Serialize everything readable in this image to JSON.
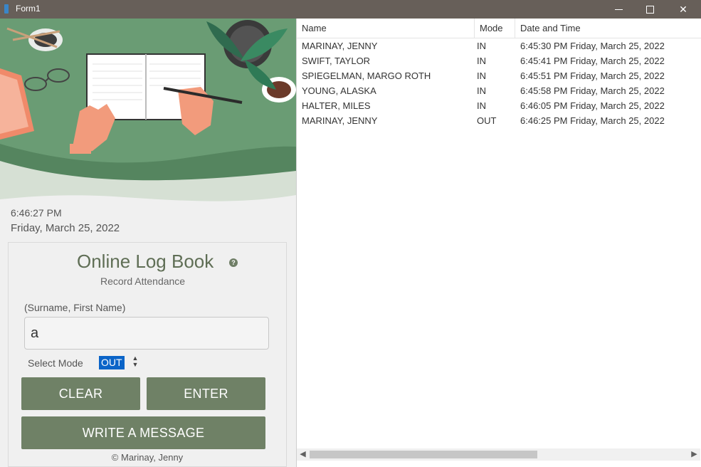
{
  "window": {
    "title": "Form1"
  },
  "clock": {
    "time": "6:46:27 PM",
    "date": "Friday, March 25, 2022"
  },
  "logbook": {
    "title": "Online Log Book",
    "subtitle": "Record Attendance",
    "name_hint": "(Surname, First Name)",
    "name_value": "a",
    "mode_label": "Select Mode",
    "mode_value": "OUT",
    "clear_label": "CLEAR",
    "enter_label": "ENTER",
    "message_label": "WRITE A MESSAGE",
    "copyright": "© Marinay, Jenny"
  },
  "list": {
    "columns": [
      "Name",
      "Mode",
      "Date and Time"
    ],
    "rows": [
      [
        "MARINAY, JENNY",
        "IN",
        "6:45:30 PM Friday, March 25, 2022"
      ],
      [
        "SWIFT, TAYLOR",
        "IN",
        "6:45:41 PM Friday, March 25, 2022"
      ],
      [
        "SPIEGELMAN, MARGO ROTH",
        "IN",
        "6:45:51 PM Friday, March 25, 2022"
      ],
      [
        "YOUNG, ALASKA",
        "IN",
        "6:45:58 PM Friday, March 25, 2022"
      ],
      [
        "HALTER, MILES",
        "IN",
        "6:46:05 PM Friday, March 25, 2022"
      ],
      [
        "MARINAY, JENNY",
        "OUT",
        "6:46:25 PM Friday, March 25, 2022"
      ]
    ]
  },
  "icons": {
    "app": "window-app-icon",
    "minimize": "minimize-icon",
    "maximize": "maximize-icon",
    "close": "close-icon",
    "help": "help-icon",
    "scroll_left": "scroll-left-icon",
    "scroll_right": "scroll-right-icon"
  },
  "colors": {
    "accent_green": "#6f8166",
    "title_green": "#5f6e55",
    "selection_blue": "#0b64c8",
    "titlebar": "#675f59"
  }
}
